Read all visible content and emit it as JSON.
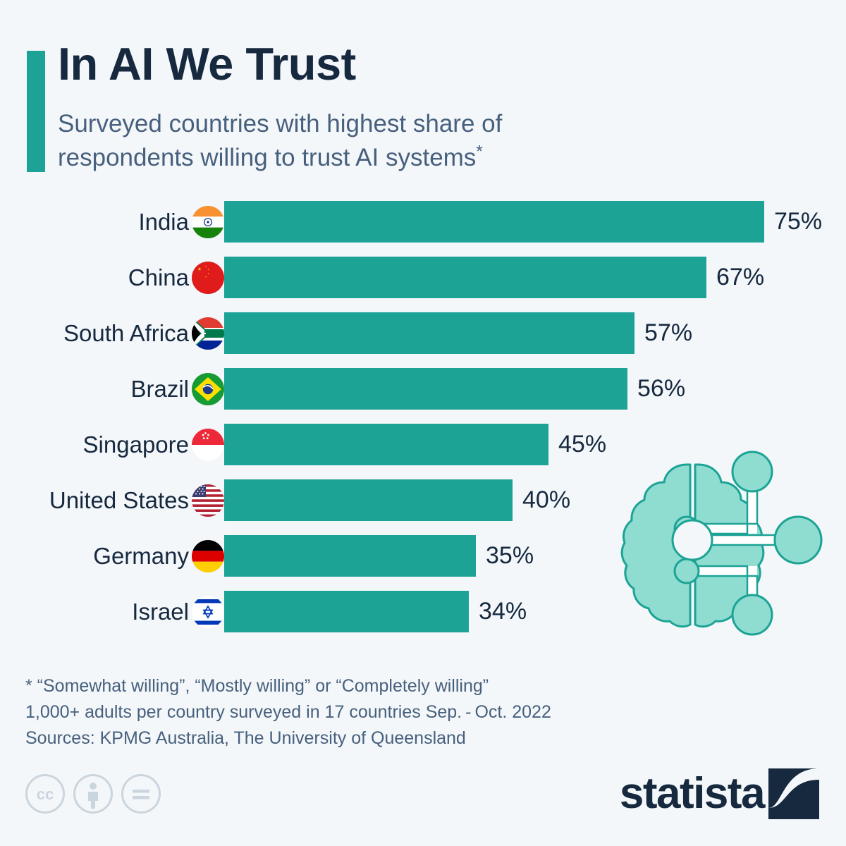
{
  "header": {
    "title": "In AI We Trust",
    "subtitle_line1": "Surveyed countries with highest share of",
    "subtitle_line2": "respondents willing to trust AI systems",
    "subtitle_asterisk": "*",
    "accent_color": "#1ca396",
    "title_color": "#16293f",
    "subtitle_color": "#47607d"
  },
  "chart_data": {
    "type": "bar",
    "orientation": "horizontal",
    "title": "In AI We Trust",
    "subtitle": "Surveyed countries with highest share of respondents willing to trust AI systems*",
    "xlabel": "",
    "ylabel": "",
    "xlim": [
      0,
      75
    ],
    "grid": false,
    "legend": null,
    "bar_color": "#1ca396",
    "value_suffix": "%",
    "categories": [
      "India",
      "China",
      "South Africa",
      "Brazil",
      "Singapore",
      "United States",
      "Germany",
      "Israel"
    ],
    "values": [
      75,
      67,
      57,
      56,
      45,
      40,
      35,
      34
    ],
    "value_labels": [
      "75%",
      "67%",
      "57%",
      "56%",
      "45%",
      "40%",
      "35%",
      "34%"
    ],
    "flags": [
      "india-flag-icon",
      "china-flag-icon",
      "south-africa-flag-icon",
      "brazil-flag-icon",
      "singapore-flag-icon",
      "united-states-flag-icon",
      "germany-flag-icon",
      "israel-flag-icon"
    ],
    "rows": [
      {
        "country": "India",
        "value": 75,
        "label": "75%",
        "flag": "india-flag-icon"
      },
      {
        "country": "China",
        "value": 67,
        "label": "67%",
        "flag": "china-flag-icon"
      },
      {
        "country": "South Africa",
        "value": 57,
        "label": "57%",
        "flag": "south-africa-flag-icon"
      },
      {
        "country": "Brazil",
        "value": 56,
        "label": "56%",
        "flag": "brazil-flag-icon"
      },
      {
        "country": "Singapore",
        "value": 45,
        "label": "45%",
        "flag": "singapore-flag-icon"
      },
      {
        "country": "United States",
        "value": 40,
        "label": "40%",
        "flag": "united-states-flag-icon"
      },
      {
        "country": "Germany",
        "value": 35,
        "label": "35%",
        "flag": "germany-flag-icon"
      },
      {
        "country": "Israel",
        "value": 34,
        "label": "34%",
        "flag": "israel-flag-icon"
      }
    ]
  },
  "graphic": {
    "name": "brain-ai-icon",
    "fill_color": "#8fddd0",
    "stroke_color": "#1ca396"
  },
  "footnotes": {
    "line1": "* “Somewhat willing”, “Mostly willing” or “Completely willing”",
    "line2": "1,000+ adults per country surveyed in 17 countries Sep. - Oct. 2022",
    "line3": "Sources: KPMG Australia, The University of Queensland"
  },
  "footer": {
    "license_icons": [
      "creative-commons-icon",
      "attribution-icon",
      "no-derivatives-icon"
    ],
    "brand": "statista",
    "brand_color": "#16293f"
  }
}
